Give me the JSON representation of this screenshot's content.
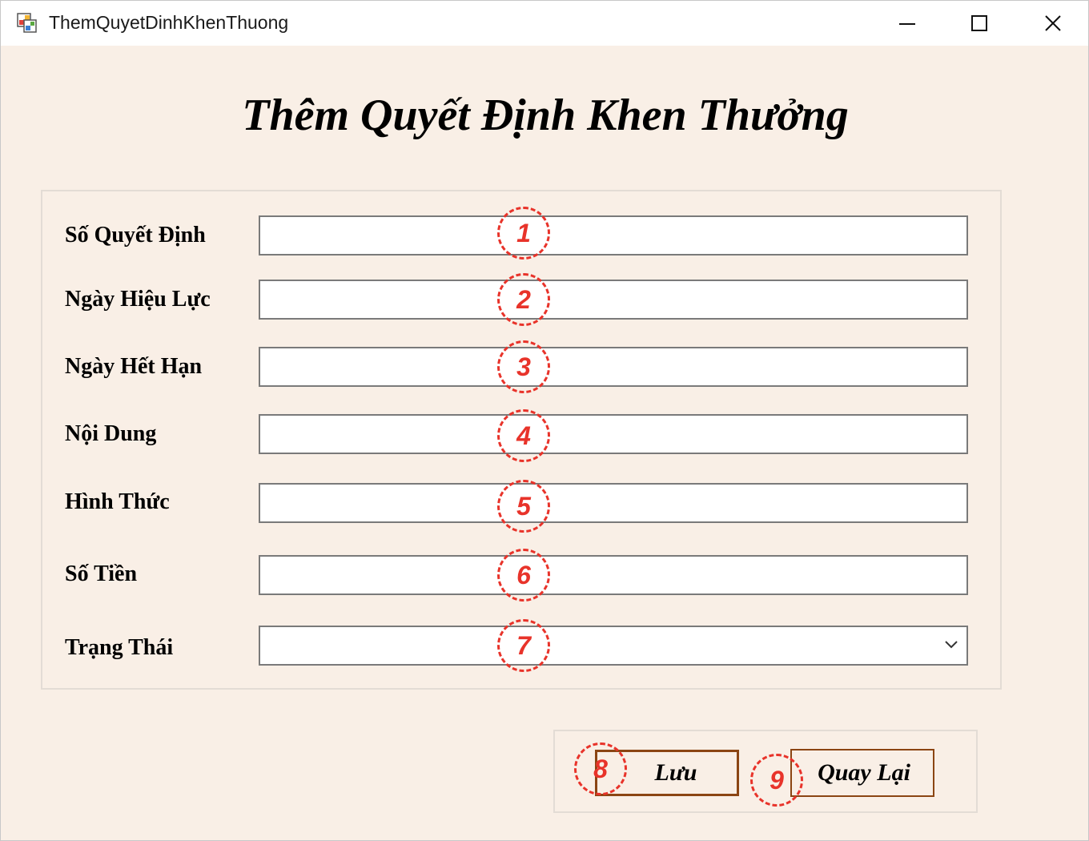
{
  "window": {
    "title": "ThemQuyetDinhKhenThuong",
    "controls": {
      "minimize_icon": "minimize-icon",
      "maximize_icon": "maximize-icon",
      "close_icon": "close-icon"
    }
  },
  "form": {
    "title": "Thêm Quyết Định Khen Thưởng",
    "fields": [
      {
        "label": "Số Quyết Định",
        "value": "",
        "badge": "1"
      },
      {
        "label": "Ngày Hiệu Lực",
        "value": "",
        "badge": "2"
      },
      {
        "label": "Ngày Hết Hạn",
        "value": "",
        "badge": "3"
      },
      {
        "label": "Nội Dung",
        "value": "",
        "badge": "4"
      },
      {
        "label": "Hình Thức",
        "value": "",
        "badge": "5"
      },
      {
        "label": "Số Tiền",
        "value": "",
        "badge": "6"
      },
      {
        "label": "Trạng Thái",
        "value": "",
        "badge": "7"
      }
    ]
  },
  "buttons": {
    "save": {
      "label": "Lưu",
      "badge": "8"
    },
    "back": {
      "label": "Quay Lại",
      "badge": "9"
    }
  },
  "colors": {
    "background": "#f9efe6",
    "annotation": "#e8332a",
    "button_border": "#8b4513"
  }
}
